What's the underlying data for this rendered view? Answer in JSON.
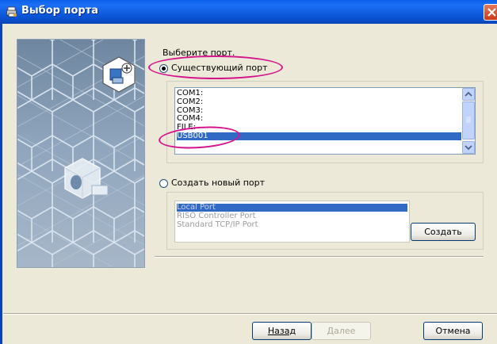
{
  "window": {
    "title": "Выбор порта"
  },
  "prompt": "Выберите порт.",
  "existing_port": {
    "label": "Существующий порт",
    "selected": true,
    "ports": [
      "COM1:",
      "COM2:",
      "COM3:",
      "COM4:",
      "FILE:",
      "USB001"
    ],
    "selected_port": "USB001"
  },
  "new_port": {
    "label": "Создать новый порт",
    "selected": false,
    "types": [
      "Local Port",
      "RISO Controller Port",
      "Standard TCP/IP Port"
    ],
    "selected_type": "Local Port",
    "create_label": "Создать"
  },
  "footer": {
    "back_label": "Назад",
    "next_label": "Далее",
    "cancel_label": "Отмена"
  },
  "colors": {
    "titlebar": "#0b55d6",
    "selection": "#316ac5",
    "highlight_ellipse": "#d4148c"
  }
}
